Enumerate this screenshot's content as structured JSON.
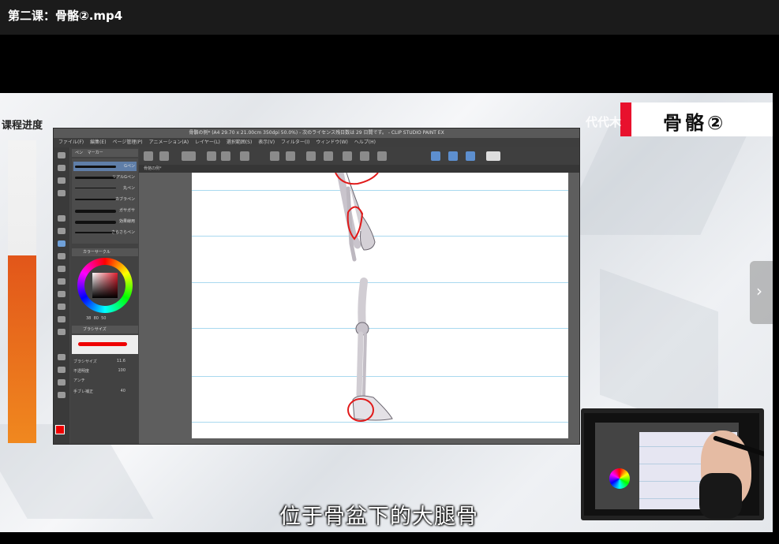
{
  "window": {
    "title": "第二课：骨骼②.mp4"
  },
  "overlay": {
    "progress_label": "课程进度",
    "progress_percent": 62,
    "lesson_title": "骨骼②",
    "watermark": "代代木"
  },
  "app": {
    "title_bar": "骨骼の例* (A4 29.70 x 21.00cm 350dpi 50.0%) - 次のライセンス残日数は 29 日間です。 - CLIP STUDIO PAINT EX",
    "menu": [
      "ファイル(F)",
      "編集(E)",
      "ページ管理(P)",
      "アニメーション(A)",
      "レイヤー(L)",
      "選択範囲(S)",
      "表示(V)",
      "フィルター(I)",
      "ウィンドウ(W)",
      "ヘルプ(H)"
    ],
    "document_tab": "骨骼の例*",
    "subtool_tabs": [
      "ペン",
      "マーカー"
    ],
    "brushes": [
      "Gペン",
      "リアルGペン",
      "丸ペン",
      "カブラペン",
      "ガサガサ",
      "効果線用",
      "さらさらペン"
    ],
    "panels": {
      "color_wheel": "カラーサークル",
      "brush_size": "ブラシサイズ"
    },
    "tool_property": {
      "brush_size_label": "ブラシサイズ",
      "brush_size_value": "11.6",
      "opacity_label": "不透明度",
      "opacity_value": "100",
      "aa_label": "アンチ",
      "stabilization_label": "手ブレ補正",
      "stabilization_value": "40"
    },
    "color_values": [
      "38",
      "80",
      "50"
    ],
    "colors": {
      "main": "#e00000",
      "canvas": "#ffffff",
      "guide_lines": "#a9d9ef"
    }
  },
  "subtitle": "位于骨盆下的大腿骨",
  "controls": {
    "next_icon": "chevron-right-icon"
  }
}
